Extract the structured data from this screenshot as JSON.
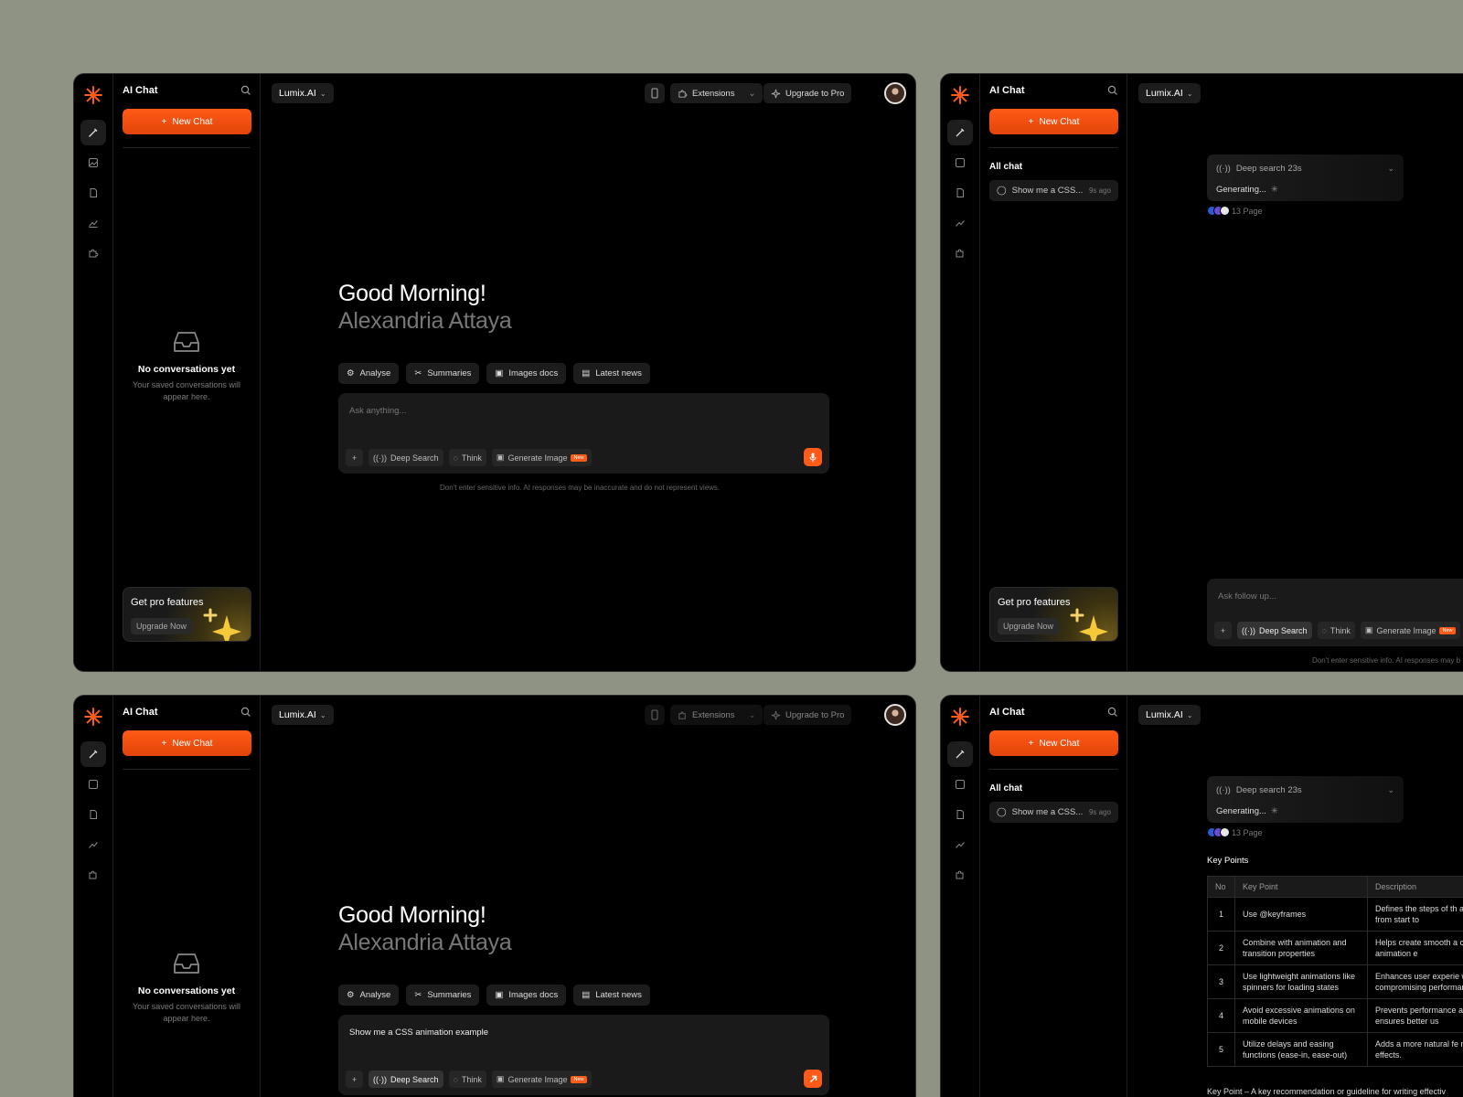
{
  "brand": {
    "accent": "#ff5a17",
    "background": "#000000",
    "canvas": "#8e9384"
  },
  "sidebar": {
    "title": "AI Chat",
    "new_chat": "New Chat",
    "empty_title": "No conversations yet",
    "empty_sub": "Your saved conversations will appear here.",
    "all_chat": "All chat",
    "chat_item": {
      "title": "Show me a CSS...",
      "time": "9s ago"
    },
    "rail_icons": [
      "pen-icon",
      "image-icon",
      "document-icon",
      "chart-icon",
      "puzzle-icon"
    ],
    "pro": {
      "title": "Get pro features",
      "button": "Upgrade Now"
    }
  },
  "topbar": {
    "model": "Lumix.AI",
    "extensions": "Extensions",
    "upgrade": "Upgrade to Pro"
  },
  "main": {
    "greeting": "Good Morning!",
    "name": "Alexandria Attaya",
    "chips": [
      "Analyse",
      "Summaries",
      "Images docs",
      "Latest news"
    ],
    "placeholder": "Ask anything...",
    "typed": "Show me a CSS animation example",
    "tools": {
      "deep_search": "Deep Search",
      "think": "Think",
      "generate_image": "Generate Image",
      "new_badge": "New"
    },
    "disclaimer": "Don't enter sensitive info. AI responses may be inaccurate and do not represent views."
  },
  "chat": {
    "deep_search": "Deep search 23s",
    "generating": "Generating...",
    "sources": "13 Page",
    "followup_placeholder": "Ask follow up...",
    "disclaimer_partial": "Don't enter sensitive info. AI responses may b",
    "key_points_title": "Key Points",
    "table": {
      "headers": [
        "No",
        "Key Point",
        "Description"
      ],
      "rows": [
        [
          "1",
          "Use @keyframes",
          "Defines the steps of th animation from start to"
        ],
        [
          "2",
          "Combine with animation and transition properties",
          "Helps create smooth a controlled animation e"
        ],
        [
          "3",
          "Use lightweight animations like spinners for loading states",
          "Enhances user experie without compromising performance."
        ],
        [
          "4",
          "Avoid excessive animations on mobile devices",
          "Prevents performance and ensures better us"
        ],
        [
          "5",
          "Utilize delays and easing functions (ease-in, ease-out)",
          "Adds a more natural fe motion effects."
        ]
      ]
    },
    "footer": "Key Point – A key recommendation or guideline for writing effectiv"
  }
}
